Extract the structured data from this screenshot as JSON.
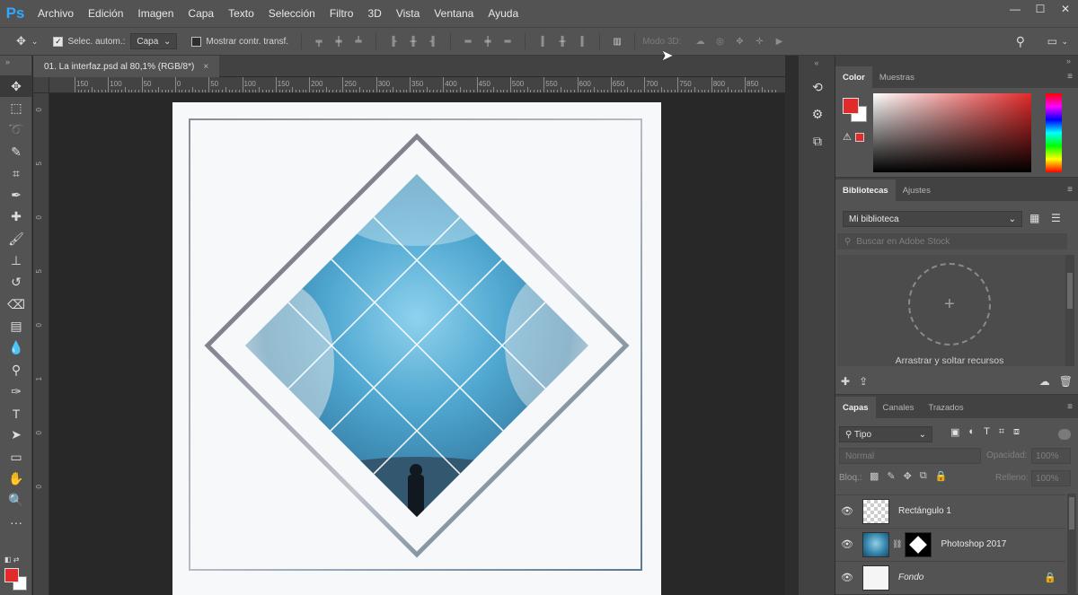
{
  "app": {
    "logo": "Ps"
  },
  "menu": [
    "Archivo",
    "Edición",
    "Imagen",
    "Capa",
    "Texto",
    "Selección",
    "Filtro",
    "3D",
    "Vista",
    "Ventana",
    "Ayuda"
  ],
  "window_controls": {
    "minimize": "—",
    "maximize": "☐",
    "close": "✕"
  },
  "options_bar": {
    "auto_select_label": "Selec. autom.:",
    "auto_select_checked": true,
    "target_value": "Capa",
    "transform_label": "Mostrar contr. transf.",
    "mode_3d_label": "Modo 3D:"
  },
  "document_tab": {
    "title": "01. La interfaz.psd al 80,1% (RGB/8*)",
    "close": "×"
  },
  "ruler_labels": [
    "150",
    "100",
    "50",
    "0",
    "50",
    "100",
    "150",
    "200",
    "250",
    "300",
    "350",
    "400",
    "450",
    "500",
    "550",
    "600",
    "650",
    "700",
    "750",
    "800",
    "850"
  ],
  "ruler_vertical_labels": [
    "0",
    "5",
    "0",
    "5",
    "0",
    "1",
    "0",
    "0"
  ],
  "colors": {
    "foreground": "#e12a2a",
    "background": "#ffffff",
    "accent": "#31a8ff"
  },
  "panels": {
    "color": {
      "tabs": [
        "Color",
        "Muestras"
      ],
      "active_tab": "Color"
    },
    "libraries": {
      "tabs": [
        "Bibliotecas",
        "Ajustes"
      ],
      "library_name": "Mi biblioteca",
      "search_placeholder": "Buscar en Adobe Stock",
      "drop_text": "Arrastrar y soltar recursos"
    },
    "layers": {
      "tabs": [
        "Capas",
        "Canales",
        "Trazados"
      ],
      "kind_filter": "Tipo",
      "blend_mode": "Normal",
      "opacity_label": "Opacidad:",
      "opacity_value": "100%",
      "lock_label": "Bloq.:",
      "fill_label": "Relleno:",
      "fill_value": "100%",
      "items": [
        {
          "name": "Rectángulo 1",
          "visible": true
        },
        {
          "name": "Photoshop 2017",
          "visible": true
        },
        {
          "name": "Fondo",
          "visible": true,
          "locked": true
        }
      ]
    }
  }
}
